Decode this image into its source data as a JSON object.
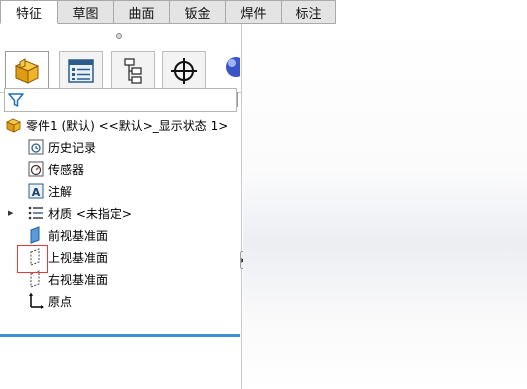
{
  "tabs": [
    "特征",
    "草图",
    "曲面",
    "钣金",
    "焊件",
    "标注"
  ],
  "panel_tabs": [
    {
      "name": "featuremanager",
      "icon": "part-icon"
    },
    {
      "name": "propertymanager",
      "icon": "property-list-icon"
    },
    {
      "name": "configurationmanager",
      "icon": "configuration-tree-icon"
    },
    {
      "name": "dimxpertmanager",
      "icon": "crosshair-target-icon"
    }
  ],
  "nav": {
    "prev": "◀",
    "next": "▶"
  },
  "tree": {
    "root": "零件1 (默认) <<默认>_显示状态 1>",
    "items": [
      {
        "label": "历史记录",
        "icon": "history-icon"
      },
      {
        "label": "传感器",
        "icon": "sensor-icon"
      },
      {
        "label": "注解",
        "icon": "annotation-icon"
      },
      {
        "label": "材质 <未指定>",
        "icon": "material-icon"
      },
      {
        "label": "前视基准面",
        "icon": "plane-icon"
      },
      {
        "label": "上视基准面",
        "icon": "plane-icon"
      },
      {
        "label": "右视基准面",
        "icon": "plane-icon"
      },
      {
        "label": "原点",
        "icon": "origin-icon"
      }
    ]
  },
  "colors": {
    "accent_line": "#3d8fd1",
    "selection_outline": "#e33b3b",
    "part_icon": "#f0b429"
  }
}
